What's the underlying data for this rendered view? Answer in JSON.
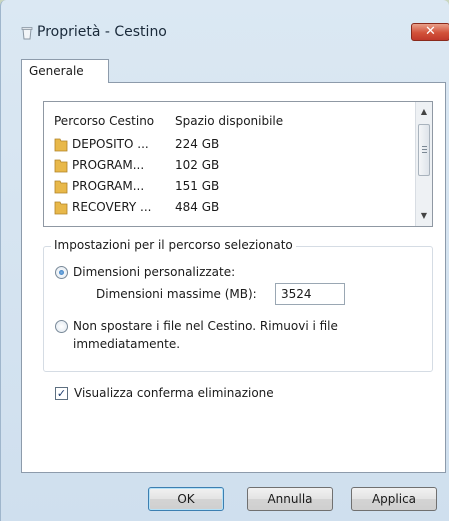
{
  "window": {
    "title": "Proprietà - Cestino",
    "close_symbol": "✕"
  },
  "tabs": [
    {
      "label": "Generale"
    }
  ],
  "locations": {
    "columns": [
      "Percorso Cestino",
      "Spazio disponibile"
    ],
    "rows": [
      {
        "name": "DEPOSITO ...",
        "space": "224 GB"
      },
      {
        "name": "PROGRAM...",
        "space": "102 GB"
      },
      {
        "name": "PROGRAM...",
        "space": "151 GB"
      },
      {
        "name": "RECOVERY ...",
        "space": "484 GB"
      }
    ]
  },
  "settings": {
    "group_title": "Impostazioni per il percorso selezionato",
    "custom_size_label": "Dimensioni personalizzate:",
    "max_size_label": "Dimensioni massime (MB):",
    "max_size_value": "3524",
    "no_move_label_line1": "Non spostare i file nel Cestino. Rimuovi i file",
    "no_move_label_line2": "immediatamente.",
    "selected_option": "custom_size"
  },
  "confirm": {
    "label": "Visualizza conferma eliminazione",
    "checked": true
  },
  "buttons": {
    "ok": "OK",
    "cancel": "Annulla",
    "apply": "Applica"
  },
  "colors": {
    "close_button": "#c0392b",
    "folder_icon": "#e8b84a",
    "page_background": "#c9d6bf"
  }
}
